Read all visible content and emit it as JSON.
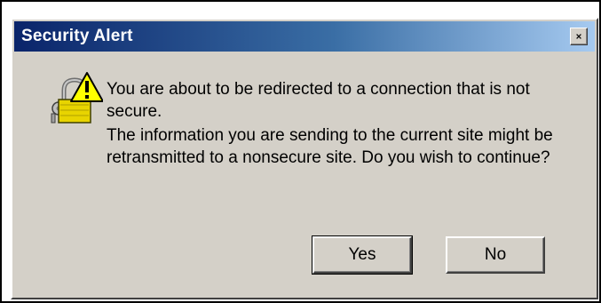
{
  "dialog": {
    "title": "Security Alert",
    "icon": "padlock-warning-icon",
    "message_primary": "You are about to be redirected to a connection that is not secure.",
    "message_secondary": "The information you are sending to the current site might be retransmitted to a nonsecure site. Do you wish to continue?",
    "buttons": {
      "yes_label": "Yes",
      "no_label": "No"
    }
  },
  "colors": {
    "titlebar_start": "#0a246a",
    "titlebar_end": "#a6caf0",
    "face": "#d4d0c8",
    "warning_yellow": "#ffff00"
  }
}
